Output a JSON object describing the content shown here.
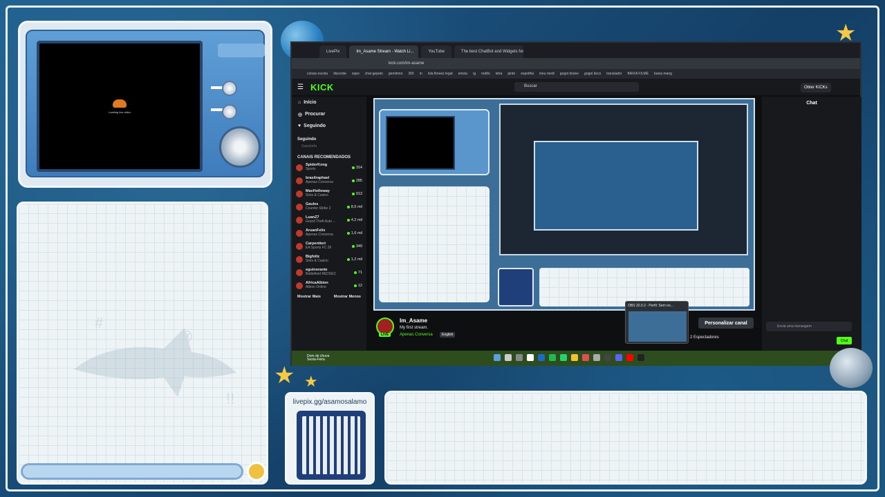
{
  "camera": {
    "loading_text": "Loading live video"
  },
  "qr": {
    "link": "livepix.gg/asamosalamo"
  },
  "browser": {
    "tabs": [
      "LivePix",
      "Im_Asame Stream - Watch Li...",
      "YouTube",
      "The best ChatBot and Widgets for K..."
    ],
    "address": "kick.com/im-asame",
    "bookmarks": [
      "coisas escola",
      "discorde",
      "zapo",
      "chat gepeto",
      "gemimno",
      "365",
      "in",
      "lola fimeez legal",
      "emoiu",
      "ig",
      "redito",
      "letra",
      "pinto",
      "espotifai",
      "meu medi",
      "gogol draive",
      "gogol docs",
      "translador",
      "BAIXA FILME",
      "baixa mang"
    ]
  },
  "kick": {
    "logo": "KICK",
    "search_placeholder": "Buscar",
    "obter": "Obter KICKs",
    "nav": [
      {
        "icon": "home-icon",
        "label": "Início"
      },
      {
        "icon": "compass-icon",
        "label": "Procurar"
      },
      {
        "icon": "heart-icon",
        "label": "Seguindo"
      }
    ],
    "following_header": "Seguindo",
    "following_item": "Ganularfa",
    "recommended_header": "CANAIS RECOMENDADOS",
    "recommended": [
      {
        "name": "SpiderKong",
        "category": "Sports",
        "count": "314"
      },
      {
        "name": "brasilraphael",
        "category": "Apenas Conversa",
        "count": "285"
      },
      {
        "name": "MaxHolloway",
        "category": "Slots & Casino",
        "count": "913"
      },
      {
        "name": "Gaules",
        "category": "Counter-Strike 2",
        "count": "8,5 mil"
      },
      {
        "name": "LuanZ7",
        "category": "Grand Theft Auto ...",
        "count": "4,2 mil"
      },
      {
        "name": "AruanFelix",
        "category": "Apenas Conversa",
        "count": "1,6 mil"
      },
      {
        "name": "Carpentieri",
        "category": "EA Sports FC 26",
        "count": "349"
      },
      {
        "name": "Bigfoltz",
        "category": "Slots & Casino",
        "count": "1,2 mil"
      },
      {
        "name": "eguinorante",
        "category": "Battlefield REDSEC",
        "count": "71"
      },
      {
        "name": "AfricaAlbion",
        "category": "Albion Online",
        "count": "12"
      }
    ],
    "show_more": "Mostrar Mais",
    "show_less": "Mostrar Menos",
    "chat_title": "Chat",
    "chat_placeholder": "Envia uma mensagem",
    "chat_button": "Chat",
    "stream": {
      "name": "Im_Asame",
      "title": "My first stream.",
      "category": "Apenas Conversa",
      "language": "English",
      "live": "LIVE",
      "customize": "Personalizar canal",
      "viewers": "2 Espectadores"
    },
    "obs_popup": "OBS 32.0.2 - Perfil: Sem no..."
  },
  "taskbar": {
    "weather_line1": "Dom de chuva",
    "weather_line2": "Sexta-Feira"
  }
}
